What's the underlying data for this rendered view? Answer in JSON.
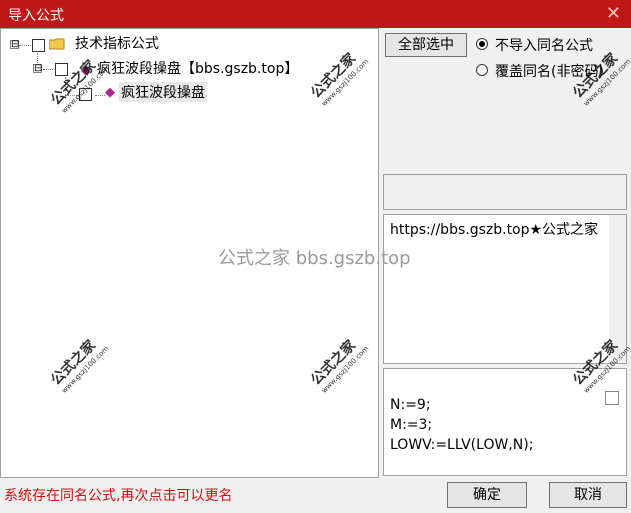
{
  "window": {
    "title": "导入公式",
    "close_glyph": "✕"
  },
  "tree": {
    "root": {
      "label": "技术指标公式",
      "expander": "⊟"
    },
    "group": {
      "label": "疯狂波段操盘【bbs.gszb.top】",
      "expander": "⊟"
    },
    "item": {
      "label": "疯狂波段操盘"
    }
  },
  "buttons": {
    "select_all": "全部选中",
    "ok": "确定",
    "cancel": "取消"
  },
  "options": {
    "no_import_same": "不导入同名公式",
    "overwrite_same": "覆盖同名(非密码)",
    "selected": "no_import_same"
  },
  "description": {
    "text": "https://bbs.gszb.top★公式之家"
  },
  "code": {
    "lines": [
      "N:=9;",
      "M:=3;",
      "LOWV:=LLV(LOW,N);"
    ]
  },
  "status": {
    "message": "系统存在同名公式,再次点击可以更名"
  },
  "watermark": {
    "center": "公式之家 bbs.gszb.top",
    "stamp": "公式之家",
    "stamp_url": "www.gszj100.com"
  },
  "colors": {
    "title_bar": "#c01818",
    "status_text": "#d01010"
  }
}
